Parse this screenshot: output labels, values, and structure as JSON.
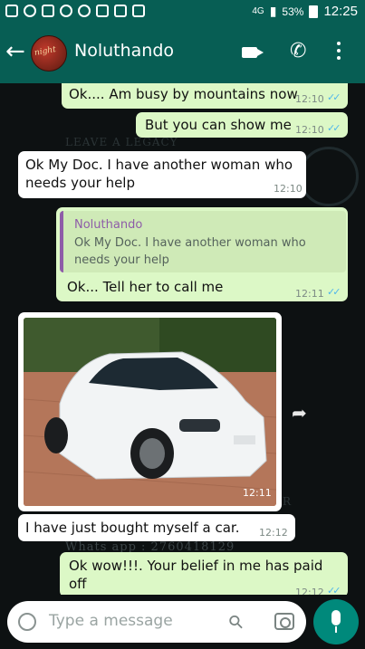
{
  "status_bar": {
    "network": "4G",
    "battery": "53%",
    "time": "12:25"
  },
  "header": {
    "contact_name": "Noluthando",
    "avatar_text": "night"
  },
  "watermark": {
    "line1": "LEAVE A LEGACY",
    "line2": "Whats app : 2760418129",
    "letter": "R"
  },
  "messages": [
    {
      "dir": "out",
      "text": "Ok.... Am busy by mountains now",
      "time": "12:10",
      "status": "read"
    },
    {
      "dir": "out",
      "text": "But you can show me",
      "time": "12:10",
      "status": "read"
    },
    {
      "dir": "in",
      "text_lines": [
        "Ok My Doc. I have another woman who",
        "needs your help"
      ],
      "time": "12:10"
    },
    {
      "dir": "out",
      "quote": {
        "name": "Noluthando",
        "lines": [
          "Ok My Doc. I have another woman who",
          "needs your help"
        ]
      },
      "text": "Ok... Tell her to call me",
      "time": "12:11",
      "status": "read"
    },
    {
      "dir": "in",
      "type": "image",
      "image_desc": "white hatchback car",
      "time": "12:11"
    },
    {
      "dir": "in",
      "text": "I have just bought myself a car.",
      "time": "12:12"
    },
    {
      "dir": "out",
      "text_lines": [
        "Ok wow!!!. Your belief in me has paid",
        "off"
      ],
      "time": "12:12",
      "status": "read"
    }
  ],
  "input": {
    "placeholder": "Type a message"
  },
  "icons": {
    "back": "arrow-left-icon",
    "video": "video-call-icon",
    "call": "phone-icon",
    "menu": "more-vert-icon",
    "forward": "share-icon",
    "emoji": "emoji-icon",
    "attach": "paperclip-icon",
    "camera": "camera-icon",
    "mic": "mic-icon"
  },
  "colors": {
    "header": "#075e54",
    "outgoing": "#dcf8c6",
    "incoming": "#ffffff",
    "tick": "#4fb6ec",
    "mic": "#00897b"
  }
}
